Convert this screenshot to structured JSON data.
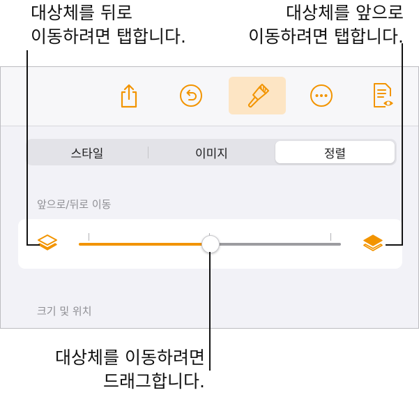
{
  "callouts": {
    "send_backward": [
      "대상체를 뒤로",
      "이동하려면 탭합니다."
    ],
    "bring_forward": [
      "대상체를 앞으로",
      "이동하려면 탭합니다."
    ],
    "drag": [
      "대상체를 이동하려면",
      "드래그합니다."
    ]
  },
  "toolbar": {
    "icons": [
      "share-icon",
      "undo-icon",
      "paintbrush-icon",
      "more-icon",
      "reading-view-icon"
    ],
    "active": "paintbrush-icon",
    "accent_color": "#f29400",
    "active_bg_color": "#fde5c4"
  },
  "segmented": {
    "tabs": [
      "스타일",
      "이미지",
      "정렬"
    ],
    "selected": "정렬"
  },
  "arrange": {
    "section_label": "앞으로/뒤로 이동",
    "slider_position": 0.5,
    "back_icon": "send-backward-icon",
    "front_icon": "bring-forward-icon"
  },
  "size_position": {
    "section_label": "크기 및 위치"
  }
}
